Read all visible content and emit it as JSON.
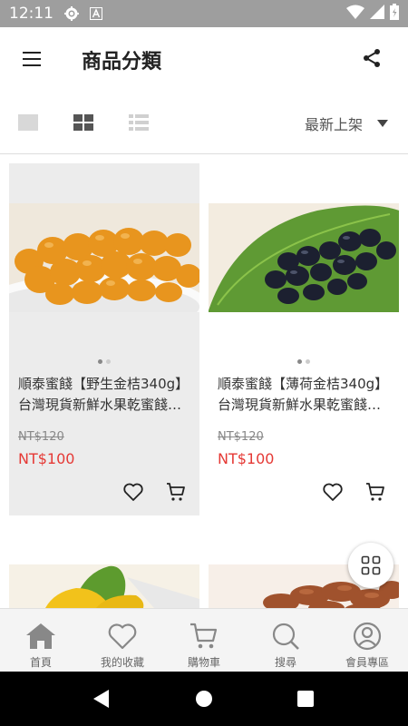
{
  "status_bar": {
    "time": "12:11",
    "icons": [
      "settings-icon",
      "font-a-icon",
      "wifi-icon",
      "signal-icon",
      "battery-icon"
    ]
  },
  "header": {
    "title": "商品分類",
    "menu_icon": "hamburger-menu-icon",
    "share_icon": "share-icon"
  },
  "toolbar": {
    "view_modes": [
      "single-view-icon",
      "grid-view-icon",
      "list-view-icon"
    ],
    "active_view": "grid",
    "sort_label": "最新上架"
  },
  "products": [
    {
      "name": "順泰蜜餞【野生金桔340g】台灣現貨新鮮水果乾蜜餞…",
      "original_price": "NT$120",
      "price": "NT$100",
      "image": "candied-kumquat",
      "image_slides": 2,
      "current_slide": 1
    },
    {
      "name": "順泰蜜餞【薄荷金桔340g】台灣現貨新鮮水果乾蜜餞…",
      "original_price": "NT$120",
      "price": "NT$100",
      "image": "mint-kumquat",
      "image_slides": 2,
      "current_slide": 1
    }
  ],
  "tab_bar": {
    "tabs": [
      {
        "label": "首頁",
        "icon": "home-icon"
      },
      {
        "label": "我的收藏",
        "icon": "heart-icon"
      },
      {
        "label": "購物車",
        "icon": "cart-icon"
      },
      {
        "label": "搜尋",
        "icon": "search-icon"
      },
      {
        "label": "會員專區",
        "icon": "user-icon"
      }
    ]
  },
  "colors": {
    "price": "#e53935",
    "status_bar": "#9e9e9e",
    "active_card": "#ececec"
  }
}
